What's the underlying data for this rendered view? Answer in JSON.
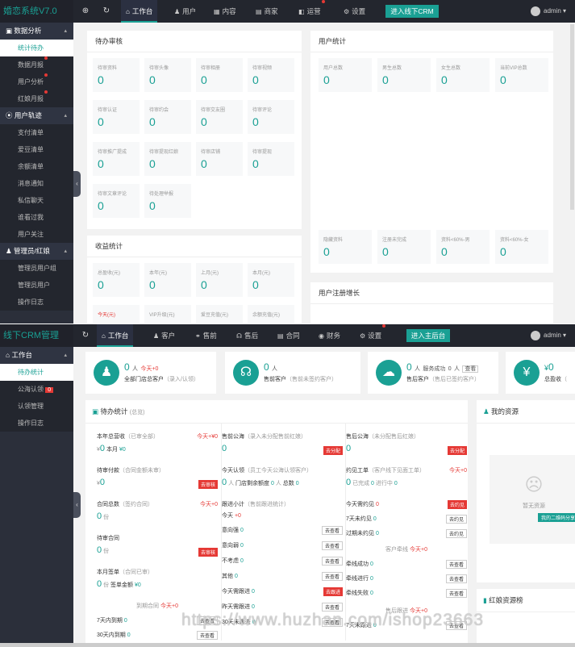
{
  "p1": {
    "logo": "婚恋系统V7.0",
    "nav": [
      {
        "icon": "⌂",
        "label": "工作台"
      },
      {
        "icon": "♟",
        "label": "用户"
      },
      {
        "icon": "▦",
        "label": "内容"
      },
      {
        "icon": "▤",
        "label": "商家"
      },
      {
        "icon": "◧",
        "label": "运营"
      },
      {
        "icon": "⚙",
        "label": "设置"
      }
    ],
    "crm_button": "进入线下CRM",
    "user": "admin",
    "sidebar": {
      "g1": "数据分析",
      "g1_items": [
        "统计待办",
        "数据月报",
        "用户分析",
        "红娘月报"
      ],
      "g2": "用户轨迹",
      "g2_items": [
        "支付清单",
        "爱豆清单",
        "余额清单",
        "消息通知",
        "私信聊天",
        "谁看过我",
        "用户关注"
      ],
      "g3": "管理员/红娘",
      "g3_items": [
        "管理员用户组",
        "管理员用户",
        "操作日志"
      ]
    },
    "pending": {
      "title": "待办审核",
      "items": [
        {
          "label": "待审资料",
          "value": "0"
        },
        {
          "label": "待审头像",
          "value": "0"
        },
        {
          "label": "待审相册",
          "value": "0"
        },
        {
          "label": "待审视频",
          "value": "0"
        },
        {
          "label": "待审认证",
          "value": "0"
        },
        {
          "label": "待审约会",
          "value": "0"
        },
        {
          "label": "待审交友圈",
          "value": "0"
        },
        {
          "label": "待审评论",
          "value": "0"
        },
        {
          "label": "待审推广提成",
          "value": "0"
        },
        {
          "label": "待审提现红娘",
          "value": "0"
        },
        {
          "label": "待审店铺",
          "value": "0"
        },
        {
          "label": "待审提现",
          "value": "0"
        },
        {
          "label": "待审文章评论",
          "value": "0"
        },
        {
          "label": "待处理举报",
          "value": "0"
        }
      ]
    },
    "income": {
      "title": "收益统计",
      "items": [
        {
          "label": "总盈收(元)",
          "value": "0"
        },
        {
          "label": "本年(元)",
          "value": "0"
        },
        {
          "label": "上月(元)",
          "value": "0"
        },
        {
          "label": "本月(元)",
          "value": "0"
        }
      ],
      "row2": [
        {
          "label": "今天(元)"
        },
        {
          "label": "VIP升级(元)"
        },
        {
          "label": "爱豆充值(元)"
        },
        {
          "label": "余额充值(元)"
        }
      ]
    },
    "users": {
      "title": "用户统计",
      "items": [
        {
          "label": "用户总数",
          "value": "0"
        },
        {
          "label": "男生总数",
          "value": "0"
        },
        {
          "label": "女生总数",
          "value": "0"
        },
        {
          "label": "当前VIP总数",
          "value": "0"
        }
      ],
      "row2": [
        {
          "label": "隐藏资料",
          "value": "0"
        },
        {
          "label": "注册未完成",
          "value": "0"
        },
        {
          "label": "资料<60%-男",
          "value": "0"
        },
        {
          "label": "资料<60%-女",
          "value": "0"
        }
      ]
    },
    "growth_title": "用户注册增长"
  },
  "p2": {
    "logo": "线下CRM管理",
    "nav": [
      {
        "icon": "⌂",
        "label": "工作台"
      },
      {
        "icon": "♟",
        "label": "客户"
      },
      {
        "icon": "⚭",
        "label": "售前"
      },
      {
        "icon": "☊",
        "label": "售后"
      },
      {
        "icon": "▤",
        "label": "合同"
      },
      {
        "icon": "◉",
        "label": "财务"
      },
      {
        "icon": "⚙",
        "label": "设置"
      }
    ],
    "main_button": "进入主后台",
    "user": "admin",
    "sidebar": {
      "g1": "工作台",
      "items": [
        {
          "label": "待办统计"
        },
        {
          "label": "公海认领",
          "badge": "0"
        },
        {
          "label": "认领管理"
        },
        {
          "label": "操作日志"
        }
      ]
    },
    "kpis": [
      {
        "num": "0",
        "unit": "人",
        "extra": "今天+0",
        "sub": "全部门店总客户",
        "subg": "（录入/认领）"
      },
      {
        "num": "0",
        "unit": "人",
        "extra": "",
        "sub": "售前客户",
        "subg": "（售前未签约客户）"
      },
      {
        "num": "0",
        "unit": "人",
        "extra": "服务成功",
        "extra_num": "0",
        "extra_unit": "人",
        "btn": "查看",
        "sub": "售后客户",
        "subg": "（售后已签约客户）"
      },
      {
        "num": "0",
        "unit": "",
        "extra": "",
        "sub": "总盈收",
        "subg": "（"
      }
    ],
    "todo": {
      "title": "待办统计",
      "title_note": "(总览)",
      "c1": {
        "total_rev": "本年总营收",
        "total_rev_note": "（已审全部）",
        "today": "今天+",
        "today_v": "¥0",
        "yen0": "¥",
        "v0": "0",
        "month": "本月",
        "month_v": "¥0",
        "pay": "待审付款",
        "pay_note": "（合同金额未审）",
        "pay_v": "0",
        "pay_btn": "去审核",
        "contract": "合同总数",
        "contract_note": "（签约合同）",
        "contract_today": "今天+0",
        "contract_v": "0",
        "unit_fen": "份",
        "pend_contract": "待审合同",
        "pend_contract_v": "0",
        "pend_btn": "去审核",
        "month_sign": "本月签单",
        "month_sign_note": "（合同已审）",
        "month_sign_v": "0",
        "sign_amt": "签单金额",
        "sign_amt_v": "¥0",
        "expire": "到期合同",
        "expire_today": "今天+0",
        "d7": "7天内到期",
        "d7v": "0",
        "d30": "30天内到期",
        "d30v": "0",
        "view": "去查看"
      },
      "c2": {
        "presale": "售前公海",
        "presale_note": "（录入未分配售前红娘）",
        "presale_v": "0",
        "assign": "去分配",
        "claim": "今天认领",
        "claim_note": "（员工今天公海认领客户）",
        "claim_v": "0",
        "claim_unit": "人",
        "remain": "门店剩余额度",
        "remain_v": "0",
        "remain_unit": "人",
        "total": "总数",
        "total_v": "0",
        "follow": "跟进小计",
        "follow_note": "（售前跟进统计）",
        "follow_today": "今天",
        "follow_today_v": "+0",
        "rows": [
          {
            "label": "意向强",
            "v": "0"
          },
          {
            "label": "意向弱",
            "v": "0"
          },
          {
            "label": "不考虑",
            "v": "0"
          },
          {
            "label": "其他",
            "v": "0"
          },
          {
            "label": "今天需跟进",
            "v": "0",
            "red": true
          },
          {
            "label": "昨天需跟进",
            "v": "0"
          },
          {
            "label": "30天未跟进",
            "v": "0"
          }
        ],
        "view": "去查看",
        "go": "去跟进"
      },
      "c3": {
        "aftersale": "售后公海",
        "aftersale_note": "（未分配售后红娘）",
        "aftersale_v": "0",
        "assign": "去分配",
        "meet": "约见工单",
        "meet_note": "（客户线下见面工单）",
        "meet_today": "今天+0",
        "done": "已完成",
        "done_v": "0",
        "doing": "进行中",
        "doing_v": "0",
        "rows1": [
          {
            "label": "今天需约见",
            "v": "0",
            "red": true
          },
          {
            "label": "7天未约见",
            "v": "0"
          },
          {
            "label": "过期未约见",
            "v": "0"
          }
        ],
        "rel": "客户牵线",
        "rel_today": "今天+0",
        "rows2": [
          {
            "label": "牵线成功",
            "v": "0"
          },
          {
            "label": "牵线进行",
            "v": "0"
          },
          {
            "label": "牵线失败",
            "v": "0"
          }
        ],
        "after": "售后跟进",
        "after_today": "今天+0",
        "after_row": {
          "label": "7天未跟进",
          "v": "0"
        },
        "see": "去约见",
        "view": "去查看"
      }
    },
    "resources": {
      "title": "我的资源",
      "empty": "暂无资源",
      "qr_btn": "我的二维码分享"
    },
    "ranking": {
      "title": "红娘资源榜"
    }
  },
  "watermark": "https://www.huzhan.com/ishop23663"
}
